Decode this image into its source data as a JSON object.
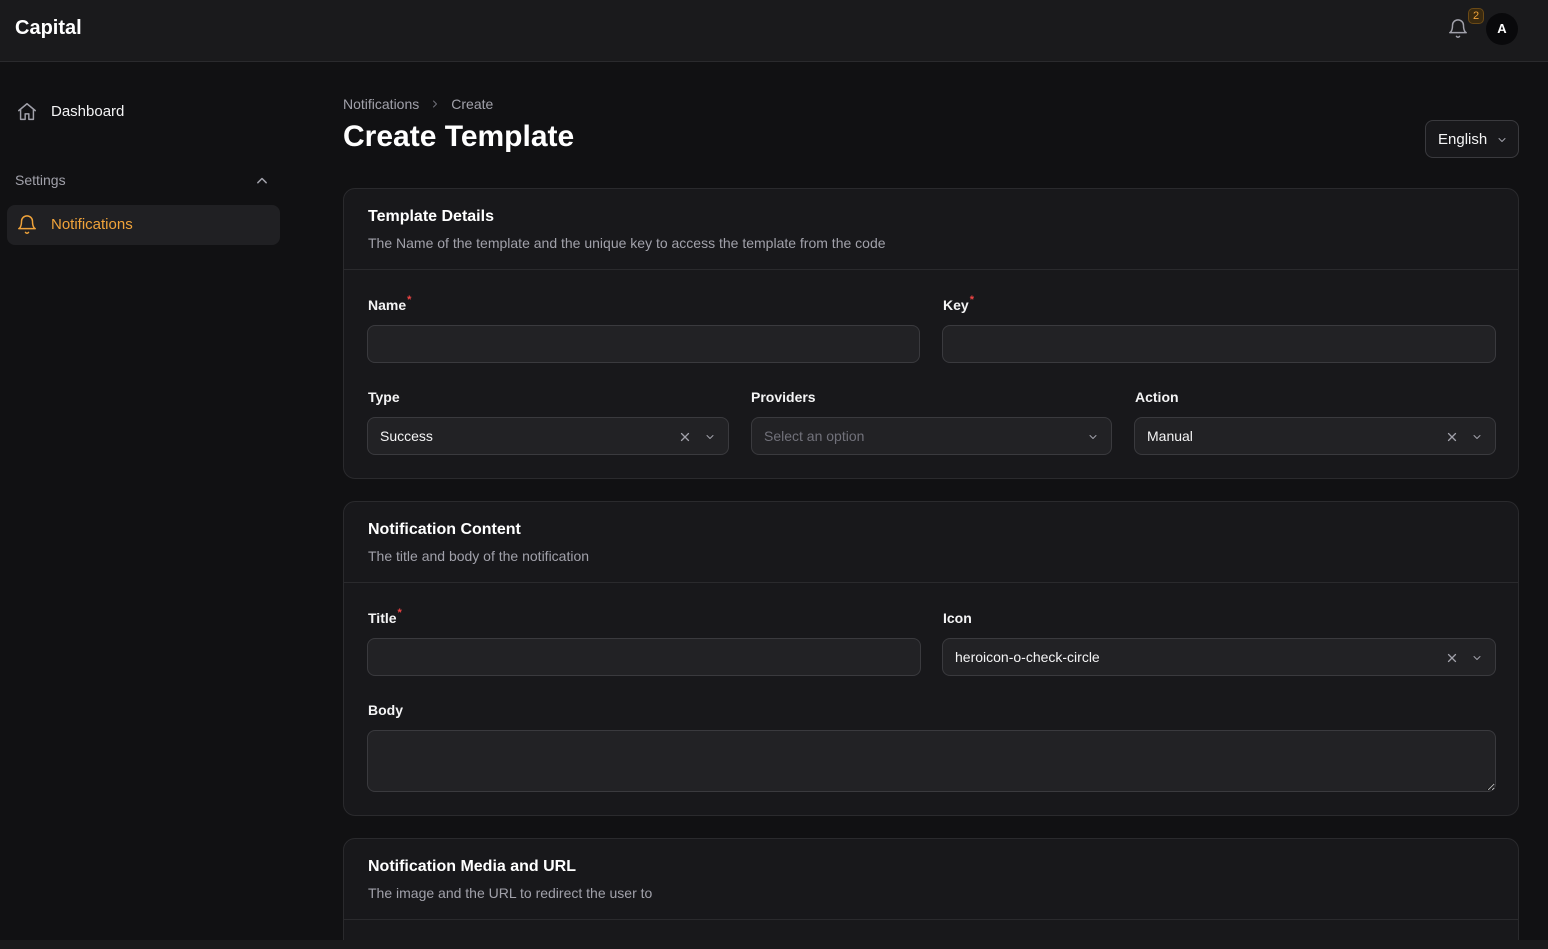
{
  "app": {
    "brand": "Capital"
  },
  "header": {
    "notification_count": "2",
    "avatar_initial": "A"
  },
  "sidebar": {
    "dashboard_label": "Dashboard",
    "group_label": "Settings",
    "notifications_label": "Notifications"
  },
  "breadcrumb": {
    "parent": "Notifications",
    "current": "Create"
  },
  "page": {
    "title": "Create Template",
    "language": "English"
  },
  "template_details": {
    "title": "Template Details",
    "description": "The Name of the template and the unique key to access the template from the code",
    "name_label": "Name",
    "key_label": "Key",
    "type_label": "Type",
    "type_value": "Success",
    "providers_label": "Providers",
    "providers_placeholder": "Select an option",
    "action_label": "Action",
    "action_value": "Manual"
  },
  "notification_content": {
    "title": "Notification Content",
    "description": "The title and body of the notification",
    "title_label": "Title",
    "icon_label": "Icon",
    "icon_value": "heroicon-o-check-circle",
    "body_label": "Body"
  },
  "media": {
    "title": "Notification Media and URL",
    "description": "The image and the URL to redirect the user to"
  },
  "colors": {
    "accent": "#f0a33a",
    "required": "#ef4444",
    "background": "#111113",
    "surface": "#18181b"
  }
}
